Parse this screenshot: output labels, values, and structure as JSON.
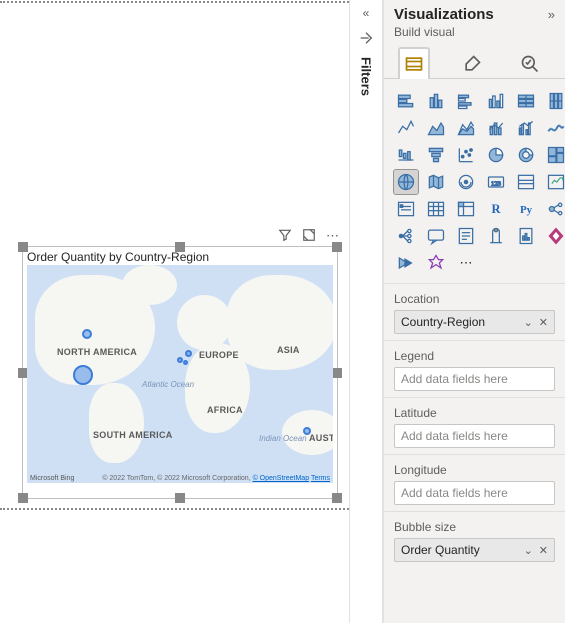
{
  "canvas": {
    "visual_title": "Order Quantity by Country-Region",
    "continents": {
      "na": "NORTH AMERICA",
      "sa": "SOUTH AMERICA",
      "eu": "EUROPE",
      "af": "AFRICA",
      "as": "ASIA",
      "au": "AUSTR"
    },
    "oceans": {
      "atlantic": "Atlantic\nOcean",
      "indian": "Indian\nOcean"
    },
    "attrib": {
      "prefix": "© 2022 TomTom, © 2022 Microsoft Corporation, ",
      "osm": "© OpenStreetMap",
      "terms": "Terms"
    },
    "brand": "Microsoft Bing"
  },
  "filters": {
    "label": "Filters"
  },
  "viz": {
    "title": "Visualizations",
    "subtitle": "Build visual",
    "charts": [
      "stacked-bar",
      "stacked-column",
      "clustered-bar",
      "clustered-column",
      "stacked-bar-100",
      "stacked-column-100",
      "line",
      "area",
      "stacked-area",
      "line-stacked-column",
      "line-clustered-column",
      "ribbon",
      "waterfall",
      "funnel",
      "scatter",
      "pie",
      "donut",
      "treemap",
      "map",
      "filled-map",
      "arcgis",
      "card",
      "multi-row-card",
      "kpi",
      "slicer",
      "table",
      "matrix",
      "r-visual",
      "python-visual",
      "key-influencers",
      "decomposition-tree",
      "qa",
      "narrative",
      "goals",
      "paginated",
      "power-apps",
      "power-automate",
      "app-source"
    ],
    "selected_chart": "map",
    "fields": {
      "location": {
        "label": "Location",
        "value": "Country-Region"
      },
      "legend": {
        "label": "Legend",
        "placeholder": "Add data fields here"
      },
      "latitude": {
        "label": "Latitude",
        "placeholder": "Add data fields here"
      },
      "longitude": {
        "label": "Longitude",
        "placeholder": "Add data fields here"
      },
      "bubble": {
        "label": "Bubble size",
        "value": "Order Quantity"
      }
    },
    "more": "⋯"
  }
}
